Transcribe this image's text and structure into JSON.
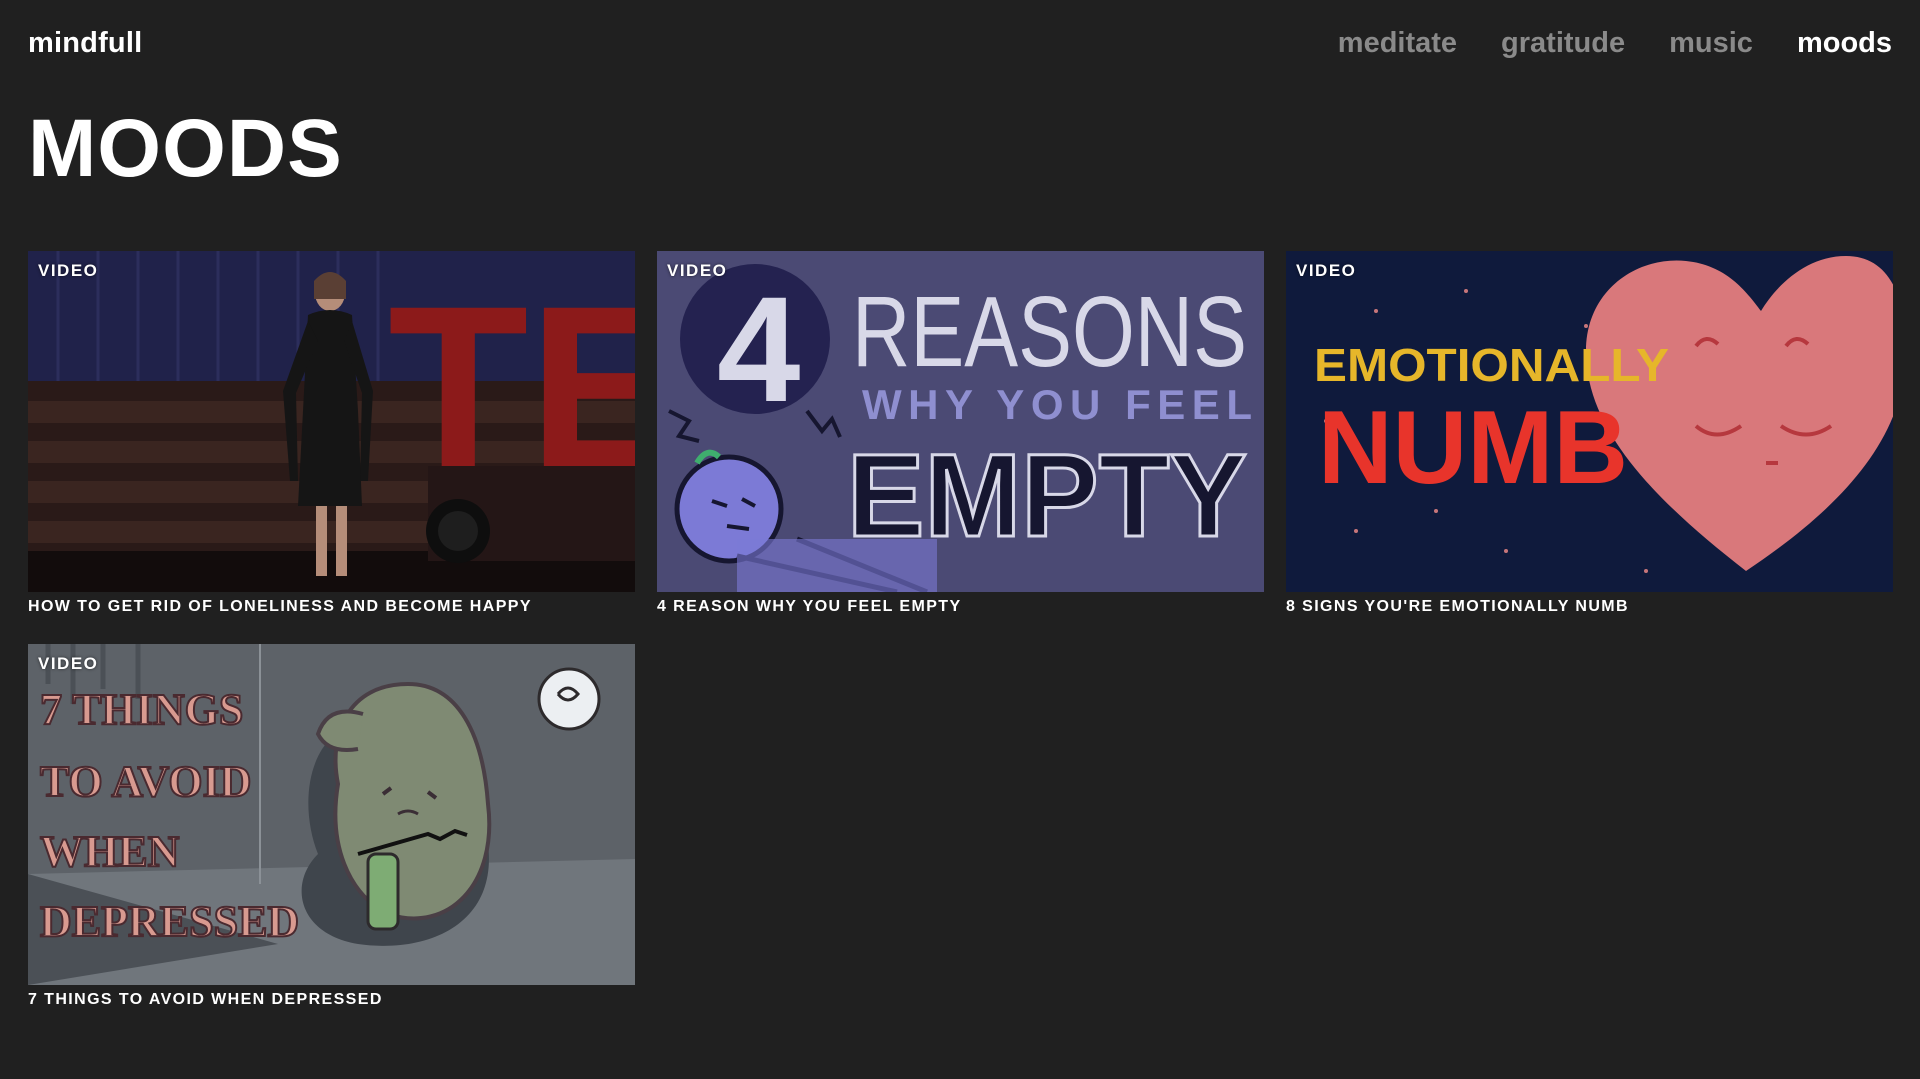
{
  "header": {
    "logo": "mindfull",
    "nav": [
      "meditate",
      "gratitude",
      "music",
      "moods"
    ],
    "active": "moods"
  },
  "page_title": "MOODS",
  "videos": [
    {
      "tag": "VIDEO",
      "title": "HOW TO GET RID OF LONELINESS AND BECOME HAPPY",
      "thumb_text": "TE"
    },
    {
      "tag": "VIDEO",
      "title": "4 REASON WHY YOU FEEL EMPTY",
      "thumb_text": {
        "num": "4",
        "line1": "REASONS",
        "line2": "WHY YOU FEEL",
        "line3": "EMPTY"
      }
    },
    {
      "tag": "VIDEO",
      "title": "8 SIGNS YOU'RE EMOTIONALLY NUMB",
      "thumb_text": {
        "line1": "EMOTIONALLY",
        "line2": "NUMB"
      }
    },
    {
      "tag": "VIDEO",
      "title": "7 THINGS TO AVOID WHEN DEPRESSED",
      "thumb_text": {
        "line1": "7 THINGS",
        "line2": "TO AVOID",
        "line3": "WHEN",
        "line4": "DEPRESSED"
      }
    }
  ],
  "colors": {
    "background": "#202020",
    "nav_inactive": "#8a8a8a",
    "nav_active": "#ffffff"
  }
}
